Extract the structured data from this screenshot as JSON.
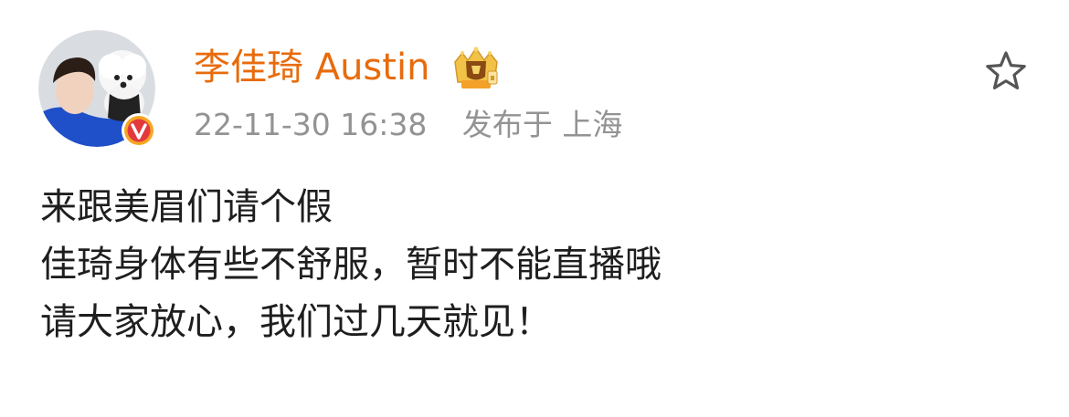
{
  "post": {
    "author_name": "李佳琦 Austin",
    "timestamp": "22-11-30 16:38",
    "location": "发布于 上海",
    "content_lines": [
      "来跟美眉们请个假",
      "佳琦身体有些不舒服，暂时不能直播哦",
      "请大家放心，我们过几天就见！"
    ]
  },
  "icons": {
    "verified": "verified-v-badge-icon",
    "vip": "vip-crown-icon",
    "favorite": "star-outline-icon"
  },
  "colors": {
    "author_name": "#e86b0c",
    "meta_text": "#939393",
    "body_text": "#1e1e1e",
    "verified_badge": "#f5a623"
  }
}
